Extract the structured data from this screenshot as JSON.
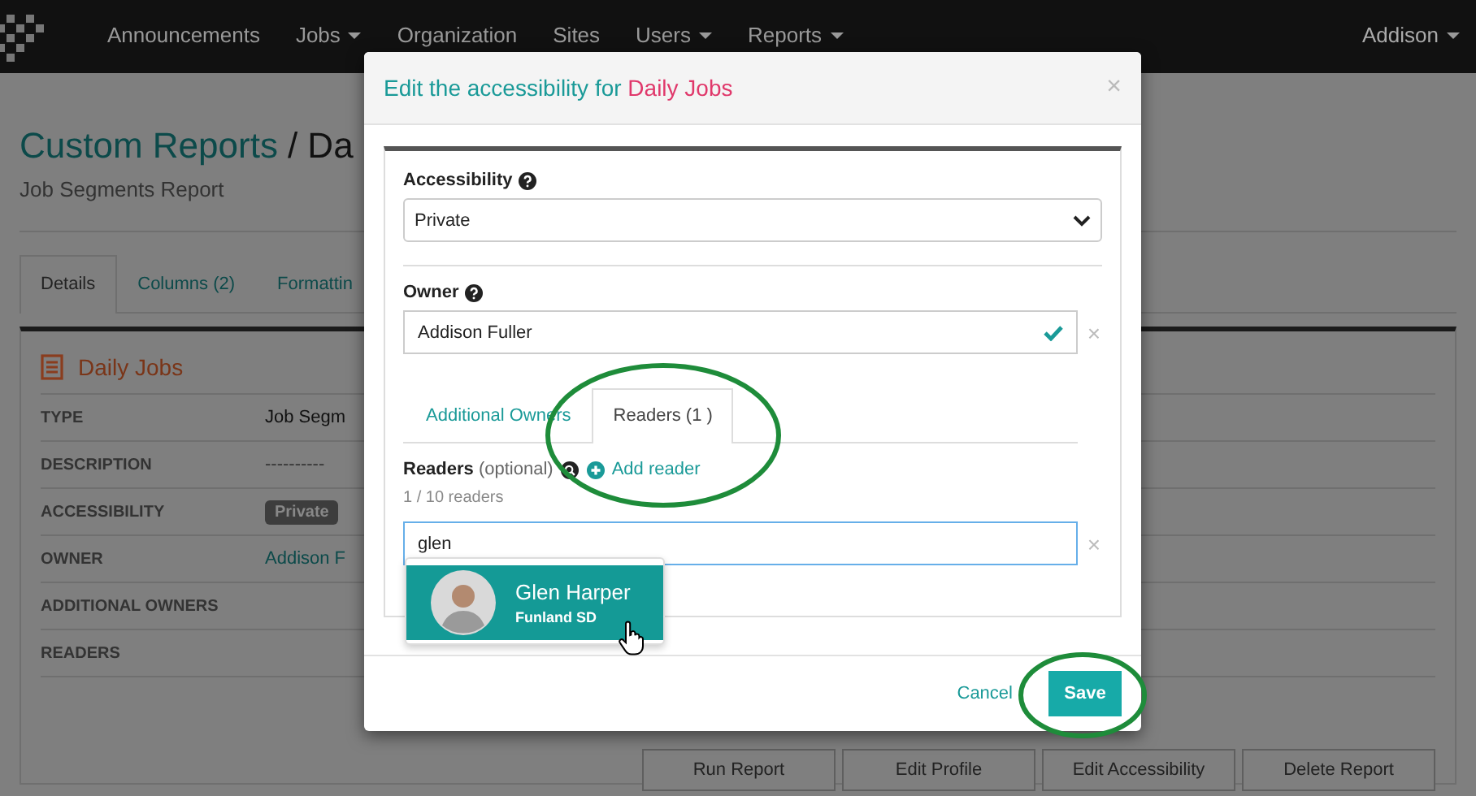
{
  "navbar": {
    "items": [
      {
        "label": "Announcements",
        "dropdown": false
      },
      {
        "label": "Jobs",
        "dropdown": true
      },
      {
        "label": "Organization",
        "dropdown": false
      },
      {
        "label": "Sites",
        "dropdown": false
      },
      {
        "label": "Users",
        "dropdown": true
      },
      {
        "label": "Reports",
        "dropdown": true
      }
    ],
    "user": {
      "label": "Addison",
      "dropdown": true
    }
  },
  "page": {
    "title": "Custom Reports",
    "title_rest": "/ Da",
    "subtitle": "Job Segments Report",
    "tabs": [
      {
        "label": "Details",
        "selected": true
      },
      {
        "label": "Columns (2)",
        "selected": false
      },
      {
        "label": "Formattin",
        "selected": false
      }
    ],
    "panel": {
      "title": "Daily Jobs",
      "rows": [
        {
          "label": "TYPE",
          "value": "Job Segm",
          "kind": "text"
        },
        {
          "label": "DESCRIPTION",
          "value": "----------",
          "kind": "muted"
        },
        {
          "label": "ACCESSIBILITY",
          "value": "Private",
          "kind": "badge"
        },
        {
          "label": "OWNER",
          "value": "Addison F",
          "kind": "link"
        },
        {
          "label": "ADDITIONAL OWNERS"
        },
        {
          "label": "READERS"
        }
      ]
    },
    "buttons": [
      "Run Report",
      "Edit Profile",
      "Edit Accessibility",
      "Delete Report"
    ]
  },
  "modal": {
    "title": "Edit the accessibility for",
    "title_highlight": "Daily Jobs",
    "close": "×",
    "accessibility": {
      "label": "Accessibility",
      "value": "Private"
    },
    "owner": {
      "label": "Owner",
      "value": "Addison Fuller",
      "valid": true,
      "remove": "×"
    },
    "tabs": [
      {
        "label": "Additional Owners",
        "selected": false
      },
      {
        "label": "Readers (1 )",
        "selected": true
      }
    ],
    "readers": {
      "label": "**Readers** (optional)",
      "add": "Add reader",
      "count": "1 / 10 readers",
      "search": "glen",
      "remove": "×",
      "suggestions": [
        {
          "name": "Glen Harper",
          "org": "Funland SD",
          "selected": true
        }
      ]
    },
    "cancel": "Cancel",
    "save": "Save"
  }
}
